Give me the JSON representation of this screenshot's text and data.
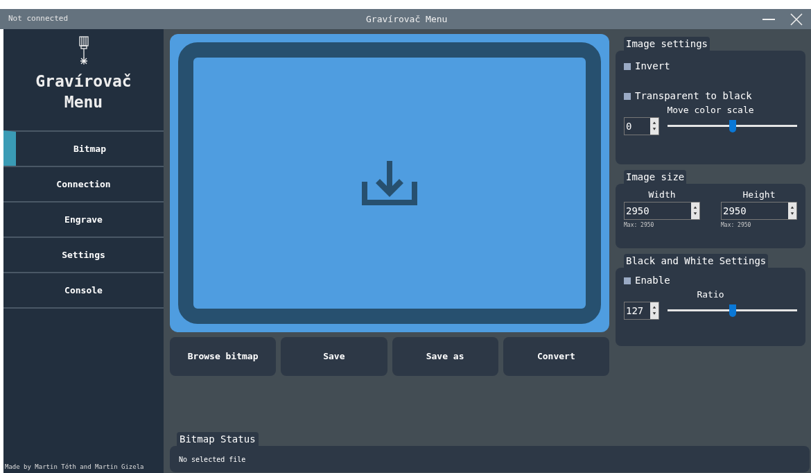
{
  "window": {
    "status": "Not connected",
    "title": "Gravírovač Menu"
  },
  "sidebar": {
    "app_name": "Gravírovač Menu",
    "items": [
      {
        "label": "Bitmap",
        "selected": true
      },
      {
        "label": "Connection",
        "selected": false
      },
      {
        "label": "Engrave",
        "selected": false
      },
      {
        "label": "Settings",
        "selected": false
      },
      {
        "label": "Console",
        "selected": false
      }
    ],
    "credits": "Made by Martin Tóth and Martin Gizela"
  },
  "buttons": [
    "Browse bitmap",
    "Save",
    "Save as",
    "Convert"
  ],
  "image_settings": {
    "title": "Image settings",
    "invert": {
      "label": "Invert",
      "checked": false
    },
    "transparent": {
      "label": "Transparent to black",
      "checked": false
    },
    "scale_label": "Move color scale",
    "scale_value": "0",
    "scale": {
      "level": 0.5
    }
  },
  "image_size": {
    "title": "Image size",
    "width": {
      "label": "Width",
      "value": "2950",
      "max": "Max: 2950"
    },
    "height": {
      "label": "Height",
      "value": "2950",
      "max": "Max: 2950"
    }
  },
  "bw_settings": {
    "title": "Black and White Settings",
    "enable": {
      "label": "Enable",
      "checked": false
    },
    "ratio_label": "Ratio",
    "ratio_value": "127",
    "ratio": {
      "level": 0.5
    }
  },
  "status": {
    "title": "Bitmap Status",
    "text": "No selected file"
  }
}
